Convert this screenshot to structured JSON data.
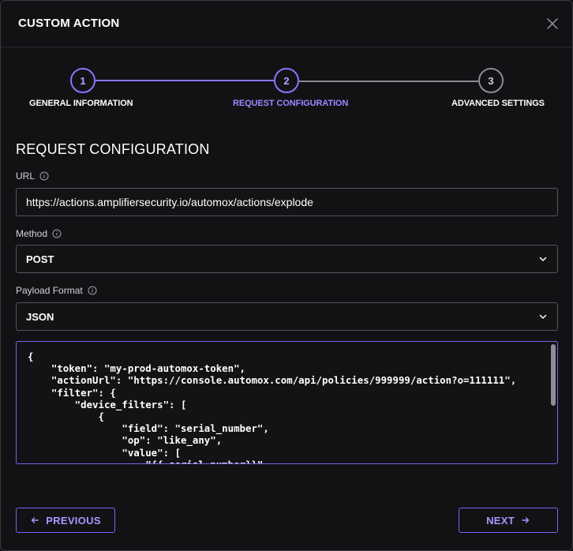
{
  "modal": {
    "title": "CUSTOM ACTION"
  },
  "stepper": {
    "steps": [
      {
        "number": "1",
        "label": "GENERAL INFORMATION",
        "state": "completed"
      },
      {
        "number": "2",
        "label": "REQUEST CONFIGURATION",
        "state": "active"
      },
      {
        "number": "3",
        "label": "ADVANCED SETTINGS",
        "state": "upcoming"
      }
    ]
  },
  "section": {
    "title": "REQUEST CONFIGURATION"
  },
  "url": {
    "label": "URL",
    "value": "https://actions.amplifiersecurity.io/automox/actions/explode"
  },
  "method": {
    "label": "Method",
    "value": "POST"
  },
  "payload_format": {
    "label": "Payload Format",
    "value": "JSON"
  },
  "payload": {
    "code": "{\n    \"token\": \"my-prod-automox-token\",\n    \"actionUrl\": \"https://console.automox.com/api/policies/999999/action?o=111111\",\n    \"filter\": {\n        \"device_filters\": [\n            {\n                \"field\": \"serial_number\",\n                \"op\": \"like_any\",\n                \"value\": [\n                    \"{{.serial_number}}\""
  },
  "buttons": {
    "previous": "PREVIOUS",
    "next": "NEXT"
  },
  "colors": {
    "accent": "#8b74ff",
    "accent_text": "#a996ff",
    "background": "#121215"
  },
  "icons": {
    "close": "close-icon",
    "info": "info-icon",
    "chevron": "chevron-down-icon",
    "arrow_left": "arrow-left-icon",
    "arrow_right": "arrow-right-icon"
  }
}
